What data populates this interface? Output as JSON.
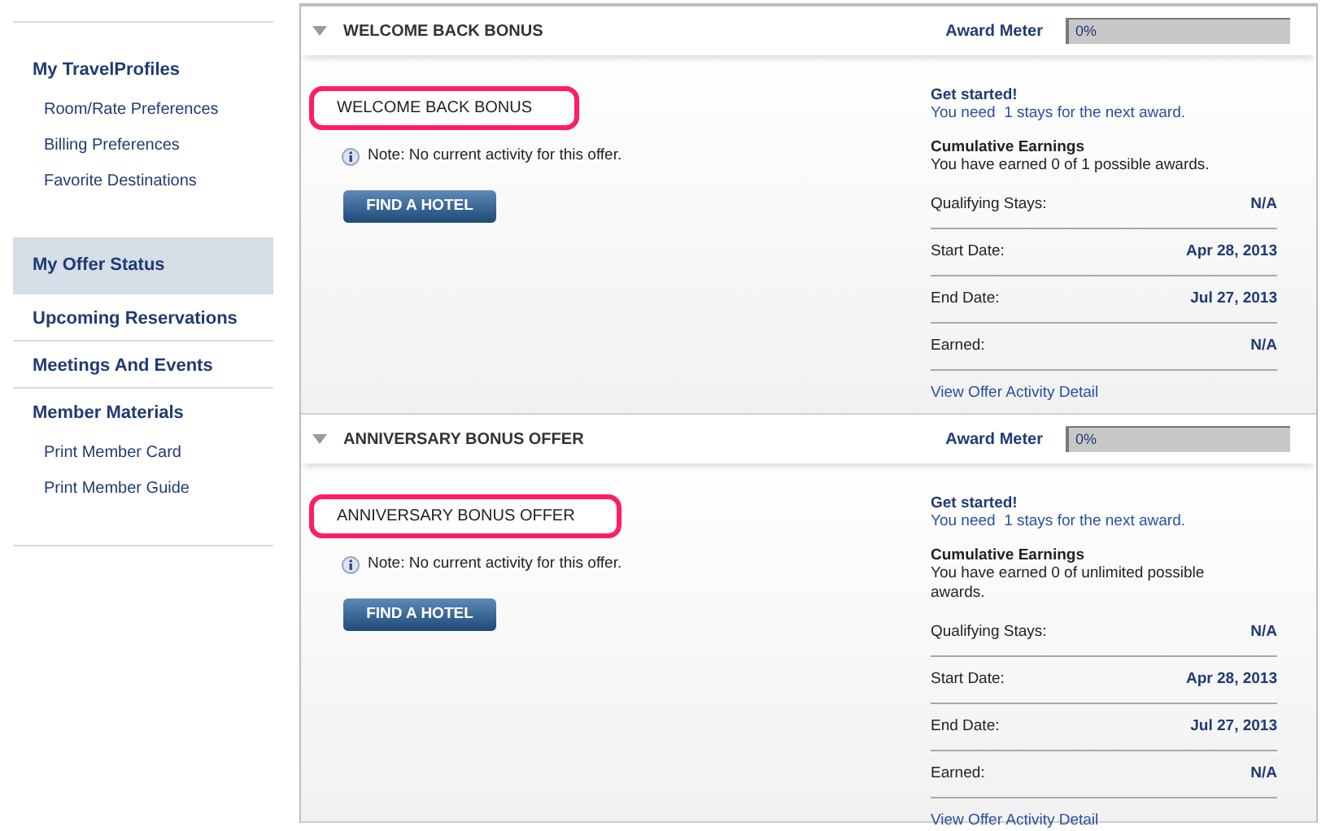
{
  "sidebar": {
    "sections": [
      {
        "label": "My TravelProfiles",
        "selected": false,
        "children": [
          {
            "label": "Room/Rate Preferences"
          },
          {
            "label": "Billing Preferences"
          },
          {
            "label": "Favorite Destinations"
          }
        ]
      },
      {
        "label": "My Offer Status",
        "selected": true
      },
      {
        "label": "Upcoming Reservations",
        "selected": false
      },
      {
        "label": "Meetings And Events",
        "selected": false
      },
      {
        "label": "Member Materials",
        "selected": false,
        "children": [
          {
            "label": "Print Member Card"
          },
          {
            "label": "Print Member Guide"
          }
        ]
      }
    ]
  },
  "offers": [
    {
      "title": "WELCOME BACK BONUS",
      "expanded": true,
      "meter_label": "Award Meter",
      "meter_reading": "0%",
      "level": 0,
      "name": "WELCOME BACK BONUS",
      "highlighted": true,
      "note": "Note: No current activity for this offer.",
      "button": "FIND A HOTEL",
      "get_started": "Get started!",
      "need": "You need  1 stays for the next award.",
      "cumulative_title": "Cumulative Earnings",
      "cumulative": "You have earned 0 of 1 possible awards.",
      "details": [
        {
          "label": "Qualifying Stays:",
          "value": "N/A"
        },
        {
          "label": "Start Date:",
          "value": "Apr 28, 2013"
        },
        {
          "label": "End Date:",
          "value": "Jul 27, 2013"
        },
        {
          "label": "Earned:",
          "value": "N/A"
        }
      ],
      "link": "View Offer Activity Detail"
    },
    {
      "title": "ANNIVERSARY BONUS OFFER",
      "expanded": true,
      "meter_label": "Award Meter",
      "meter_reading": "0%",
      "level": 0,
      "name": "ANNIVERSARY BONUS OFFER",
      "highlighted": true,
      "note": "Note: No current activity for this offer.",
      "button": "FIND A HOTEL",
      "get_started": "Get started!",
      "need": "You need  1 stays for the next award.",
      "cumulative_title": "Cumulative Earnings",
      "cumulative": "You have earned 0 of unlimited possible awards.",
      "details": [
        {
          "label": "Qualifying Stays:",
          "value": "N/A"
        },
        {
          "label": "Start Date:",
          "value": "Apr 28, 2013"
        },
        {
          "label": "End Date:",
          "value": "Jul 27, 2013"
        },
        {
          "label": "Earned:",
          "value": "N/A"
        }
      ],
      "link": "View Offer Activity Detail"
    }
  ]
}
